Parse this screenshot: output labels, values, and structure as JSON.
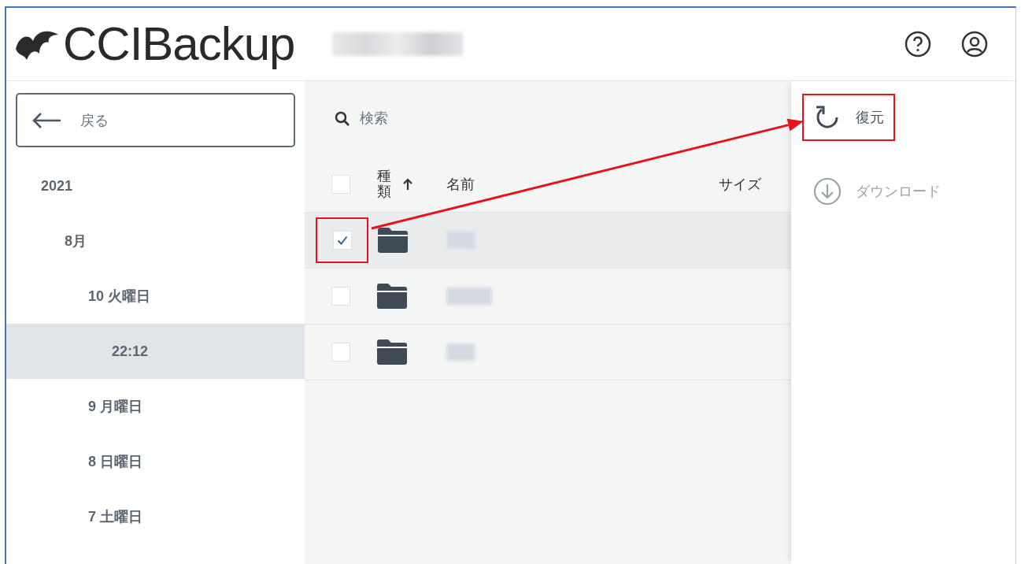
{
  "header": {
    "logo": "CCIBackup"
  },
  "sidebar": {
    "back_button": "戻る",
    "tree": [
      {
        "label": "2021",
        "selected": false,
        "children": [
          {
            "label": "8月",
            "selected": false,
            "children": [
              {
                "label": "10 火曜日",
                "selected": false,
                "children": [
                  {
                    "label": "22:12",
                    "selected": true
                  }
                ]
              },
              {
                "label": "9 月曜日",
                "selected": false
              },
              {
                "label": "8 日曜日",
                "selected": false
              },
              {
                "label": "7 土曜日",
                "selected": false
              }
            ]
          }
        ]
      }
    ]
  },
  "search": {
    "placeholder": "検索"
  },
  "table": {
    "select_all_checked": false,
    "columns": [
      {
        "label": "種類",
        "sorted": true
      },
      {
        "label": "名前",
        "sorted": false
      },
      {
        "label": "サイズ",
        "sorted": false
      }
    ],
    "rows": [
      {
        "kind": "folder",
        "checked": true,
        "highlighted": true
      },
      {
        "kind": "folder",
        "checked": false,
        "highlighted": false
      },
      {
        "kind": "folder",
        "checked": false,
        "highlighted": false
      }
    ]
  },
  "actions": [
    {
      "kind": "restore",
      "label": "復元",
      "disabled": false,
      "highlighted": true
    },
    {
      "kind": "download",
      "label": "ダウンロード",
      "disabled": true,
      "highlighted": false
    }
  ]
}
